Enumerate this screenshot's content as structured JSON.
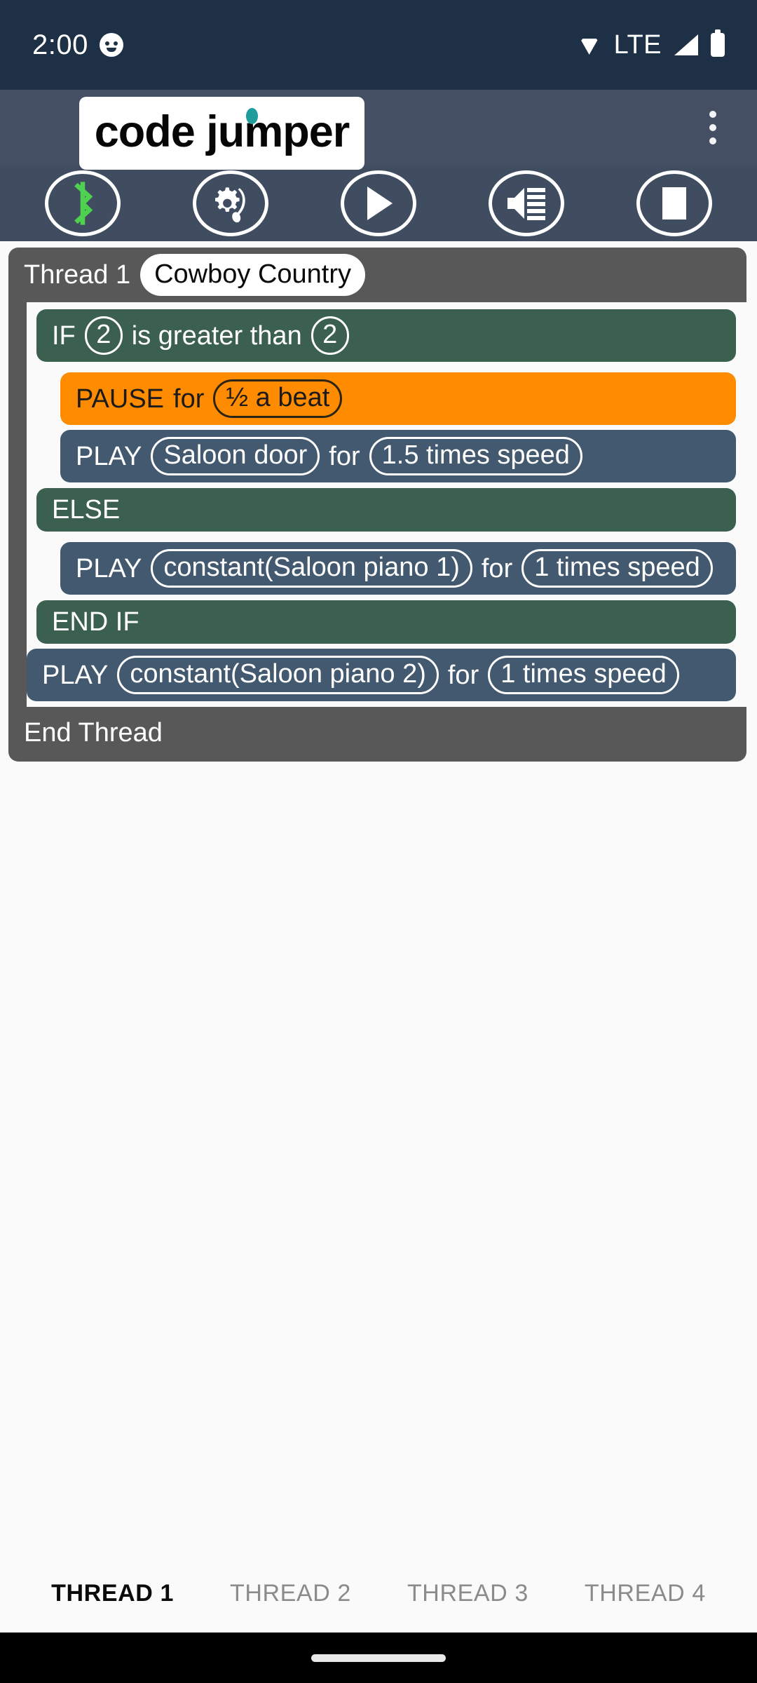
{
  "status_bar": {
    "time": "2:00",
    "app_badge_icon": "app-notification-icon",
    "wifi_icon": "wifi-icon",
    "network_label": "LTE",
    "signal_icon": "cellular-signal-icon",
    "battery_icon": "battery-full-icon",
    "background_color": "#1d3045"
  },
  "header": {
    "logo_text": "code jumper",
    "logo_accent_color": "#1f9c9c",
    "overflow_label": "more-options",
    "background_color": "#454f63"
  },
  "toolbar": {
    "background_color": "#404d61",
    "buttons": [
      {
        "name": "bluetooth-button",
        "icon": "bluetooth-icon",
        "color": "#4ed14e"
      },
      {
        "name": "sound-settings-button",
        "icon": "gear-music-note-icon",
        "color": "#ffffff"
      },
      {
        "name": "play-button",
        "icon": "play-icon",
        "color": "#ffffff"
      },
      {
        "name": "volume-button",
        "icon": "speaker-volume-icon",
        "color": "#ffffff"
      },
      {
        "name": "stop-button",
        "icon": "stop-icon",
        "color": "#ffffff"
      }
    ]
  },
  "program": {
    "thread_label": "Thread 1",
    "thread_name": "Cowboy Country",
    "end_thread_label": "End Thread",
    "colors": {
      "thread": "#585858",
      "if": "#3b6050",
      "play": "#42596f",
      "pause": "#ff8c00"
    },
    "blocks": {
      "if_keyword": "IF",
      "if_operand_a": "2",
      "if_comparator": "is greater than",
      "if_operand_b": "2",
      "pause_keyword": "PAUSE",
      "pause_for": "for",
      "pause_value": "½ a beat",
      "play1_keyword": "PLAY",
      "play1_sound": "Saloon door",
      "play1_for": "for",
      "play1_speed": "1.5 times speed",
      "else_keyword": "ELSE",
      "play2_keyword": "PLAY",
      "play2_sound": "constant(Saloon piano 1)",
      "play2_for": "for",
      "play2_speed": "1 times speed",
      "end_if_keyword": "END IF",
      "play3_keyword": "PLAY",
      "play3_sound": "constant(Saloon piano 2)",
      "play3_for": "for",
      "play3_speed": "1 times speed"
    }
  },
  "tabs": {
    "active_index": 0,
    "items": [
      {
        "label": "THREAD 1"
      },
      {
        "label": "THREAD 2"
      },
      {
        "label": "THREAD 3"
      },
      {
        "label": "THREAD 4"
      }
    ]
  },
  "nav_bar": {
    "home_indicator": "home-indicator"
  }
}
